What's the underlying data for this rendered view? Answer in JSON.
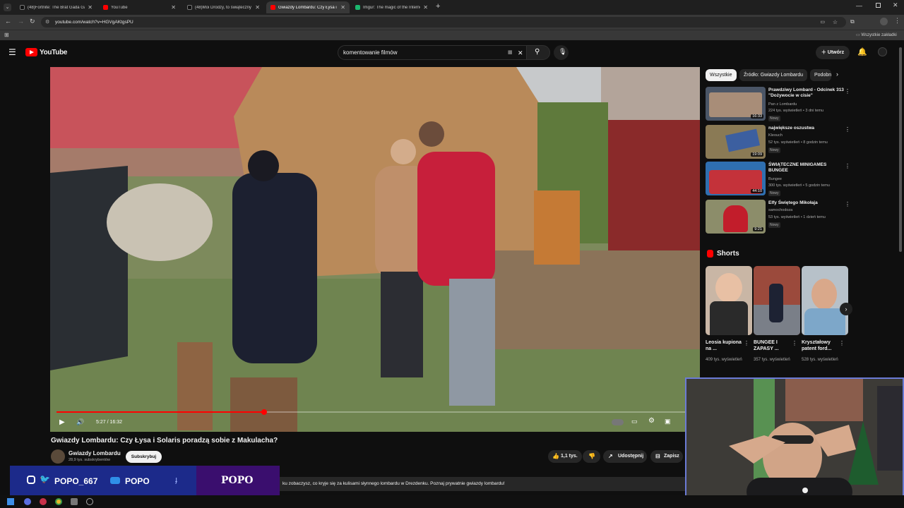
{
  "browser": {
    "tabs": [
      {
        "title": "(48)Fortnite: The Brat Gada Gada",
        "active": false
      },
      {
        "title": "YouTube",
        "active": false
      },
      {
        "title": "(48)Moi Drodzy, to świąteczny",
        "active": false
      },
      {
        "title": "Gwiazdy Lombardu: Czy Łysa i",
        "active": true
      },
      {
        "title": "Imgur: The magic of the Internet",
        "active": false
      }
    ],
    "new_tab": "+",
    "url": "youtube.com/watch?v=HGVgAKtgsPU",
    "bookmarks_label": "Wszystkie zakładki"
  },
  "youtube": {
    "logo_text": "YouTube",
    "search_value": "komentowanie filmów",
    "create_label": "Utwórz"
  },
  "player": {
    "time": "5:27 / 16:32",
    "progress": 0.33
  },
  "video": {
    "title": "Gwiazdy Lombardu: Czy Łysa i Solaris poradzą sobie z Makulacha?",
    "channel": "Gwiazdy Lombardu",
    "subscribers": "28,9 tys. subskrybentów",
    "subscribe_label": "Subskrybuj",
    "likes": "1,1 tys.",
    "share_label": "Udostępnij",
    "save_label": "Zapisz",
    "description": "ku zobaczysz, co kryje się za kulisami słynnego lombardu w Drezdenku. Poznaj prywatnie gwiazdy lombardu!"
  },
  "chips": [
    "Wszystkie",
    "Źródło: Gwiazdy Lombardu",
    "Podobne"
  ],
  "recommendations": [
    {
      "title": "Prawdziwy Lombard - Odcinek 313 \"Dożywocie w cisie\"",
      "channel": "Pan z Lombardu",
      "meta": "224 tys. wyświetleń • 3 dni temu",
      "badge": "Nowy",
      "duration": "16:33"
    },
    {
      "title": "największe oszustwa",
      "channel": "Kleouch",
      "meta": "52 tys. wyświetleń • 8 godzin temu",
      "badge": "Nowy",
      "duration": "19:09"
    },
    {
      "title": "ŚWIĄTECZNE MINIGAMES BUNGEE",
      "channel": "Bungee",
      "meta": "300 tys. wyświetleń • 5 godzin temu",
      "badge": "Nowy",
      "duration": "44:10"
    },
    {
      "title": "Elfy Świętego Mikołaja",
      "channel": "samochodoza",
      "meta": "53 tys. wyświetleń • 1 dzień temu",
      "badge": "Nowy",
      "duration": "9:21"
    }
  ],
  "shorts": {
    "heading": "Shorts",
    "items": [
      {
        "title": "Leosia kupiona na ...",
        "views": "409 tys. wyświetleń"
      },
      {
        "title": "BUNGEE I ZAPASY ...",
        "views": "357 tys. wyświetleń"
      },
      {
        "title": "Kryształowy patent ford...",
        "views": "528 tys. wyświetleń"
      }
    ]
  },
  "overlay": {
    "handle": "POPO_667",
    "yt_name": "POPO",
    "brand": "POPO"
  }
}
